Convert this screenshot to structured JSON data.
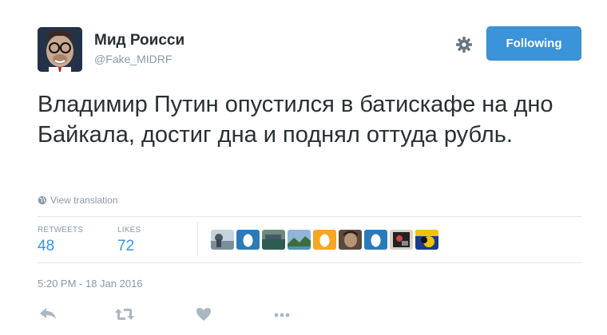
{
  "user": {
    "name": "Мид Роисси",
    "handle": "@Fake_MIDRF"
  },
  "follow_button": {
    "label": "Following"
  },
  "tweet": {
    "text": "Владимир Путин опустился в батискафе на дно Байкала, достиг дна и поднял оттуда рубль."
  },
  "view_translation": {
    "label": "View translation"
  },
  "stats": {
    "retweets_label": "RETWEETS",
    "retweets_count": "48",
    "likes_label": "LIKES",
    "likes_count": "72"
  },
  "likers": [
    {
      "icon": "photo-avatar",
      "color": "#6b7f8c"
    },
    {
      "icon": "egg-avatar",
      "color": "#2b7bb9"
    },
    {
      "icon": "photo-avatar",
      "color": "#2f6b62"
    },
    {
      "icon": "photo-avatar",
      "color": "#3f7bb0"
    },
    {
      "icon": "egg-avatar",
      "color": "#f5a623"
    },
    {
      "icon": "photo-avatar",
      "color": "#5a4a3c"
    },
    {
      "icon": "egg-avatar",
      "color": "#2b7bb9"
    },
    {
      "icon": "photo-avatar",
      "color": "#222222"
    },
    {
      "icon": "photo-avatar",
      "color": "#1a3a8a"
    }
  ],
  "timestamp": "5:20 PM - 18 Jan 2016",
  "actions": [
    "reply-icon",
    "retweet-icon",
    "like-icon",
    "more-icon"
  ],
  "colors": {
    "accent": "#3b94d9",
    "muted": "#8899a6",
    "text": "#292f33"
  }
}
